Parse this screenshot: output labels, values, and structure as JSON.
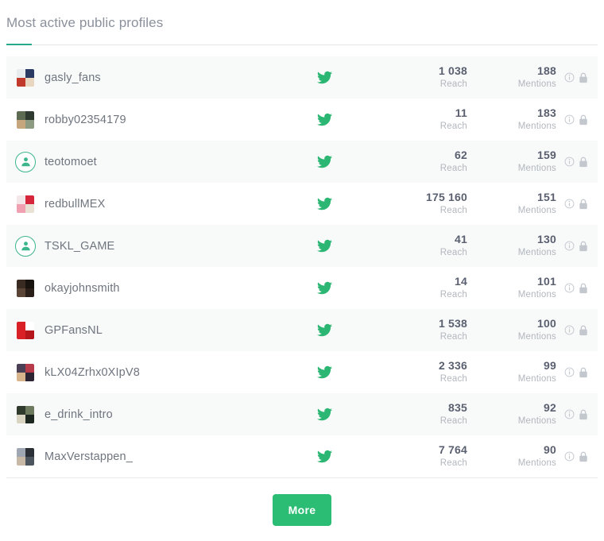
{
  "panel": {
    "title": "Most active public profiles",
    "accent_color": "#27a98b"
  },
  "columns": {
    "reach_label": "Reach",
    "mentions_label": "Mentions"
  },
  "network": {
    "name": "twitter",
    "icon": "twitter-bird-icon",
    "color": "#2cb673"
  },
  "row_icons": {
    "info": "info-circle-icon",
    "lock": "lock-icon",
    "color": "#c3c8cf"
  },
  "rows": [
    {
      "username": "gasly_fans",
      "reach": "1 038",
      "mentions": "188",
      "avatar_type": "photo",
      "avatar_name": "avatar-gasly-fans"
    },
    {
      "username": "robby02354179",
      "reach": "11",
      "mentions": "183",
      "avatar_type": "photo",
      "avatar_name": "avatar-robby02354179"
    },
    {
      "username": "teotomoet",
      "reach": "62",
      "mentions": "159",
      "avatar_type": "generic",
      "avatar_name": "avatar-teotomoet"
    },
    {
      "username": "redbullMEX",
      "reach": "175 160",
      "mentions": "151",
      "avatar_type": "photo",
      "avatar_name": "avatar-redbullmex"
    },
    {
      "username": "TSKL_GAME",
      "reach": "41",
      "mentions": "130",
      "avatar_type": "generic",
      "avatar_name": "avatar-tskl-game"
    },
    {
      "username": "okayjohnsmith",
      "reach": "14",
      "mentions": "101",
      "avatar_type": "photo",
      "avatar_name": "avatar-okayjohnsmith"
    },
    {
      "username": "GPFansNL",
      "reach": "1 538",
      "mentions": "100",
      "avatar_type": "photo",
      "avatar_name": "avatar-gpfansnl"
    },
    {
      "username": "kLX04Zrhx0XIpV8",
      "reach": "2 336",
      "mentions": "99",
      "avatar_type": "photo",
      "avatar_name": "avatar-klx04zrhx0xipv8"
    },
    {
      "username": "e_drink_intro",
      "reach": "835",
      "mentions": "92",
      "avatar_type": "photo",
      "avatar_name": "avatar-e-drink-intro"
    },
    {
      "username": "MaxVerstappen_",
      "reach": "7 764",
      "mentions": "90",
      "avatar_type": "photo",
      "avatar_name": "avatar-maxverstappen"
    }
  ],
  "footer": {
    "more_label": "More",
    "more_color": "#2bbd73"
  }
}
